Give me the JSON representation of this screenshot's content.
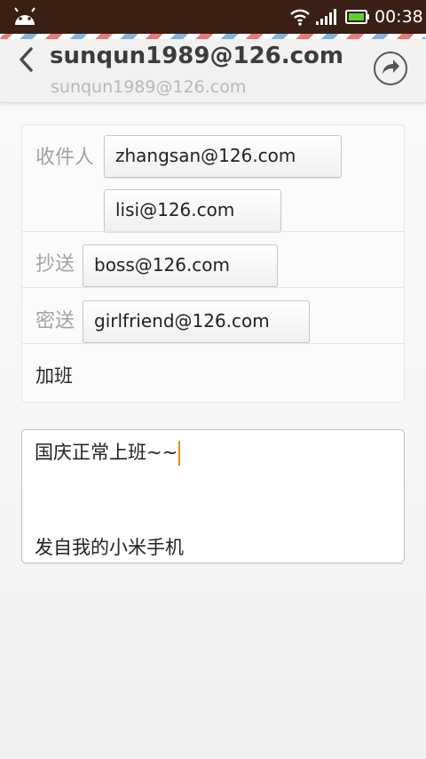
{
  "status_bar": {
    "time": "00:38",
    "icons": [
      "android-icon",
      "wifi-icon",
      "signal-icon",
      "battery-icon"
    ]
  },
  "header": {
    "title": "sunqun1989@126.com",
    "subtitle": "sunqun1989@126.com",
    "back_icon": "chevron-left-icon",
    "forward_icon": "forward-arrow-icon"
  },
  "form": {
    "to_label": "收件人",
    "to_recipients": [
      "zhangsan@126.com",
      "lisi@126.com"
    ],
    "cc_label": "抄送",
    "cc_recipients": [
      "boss@126.com"
    ],
    "bcc_label": "密送",
    "bcc_recipients": [
      "girlfriend@126.com"
    ],
    "subject": "加班"
  },
  "body": {
    "text": "国庆正常上班~~",
    "signature": "发自我的小米手机"
  },
  "colors": {
    "status_bar_bg": "#3a1f14",
    "cursor": "#e08a1c"
  }
}
